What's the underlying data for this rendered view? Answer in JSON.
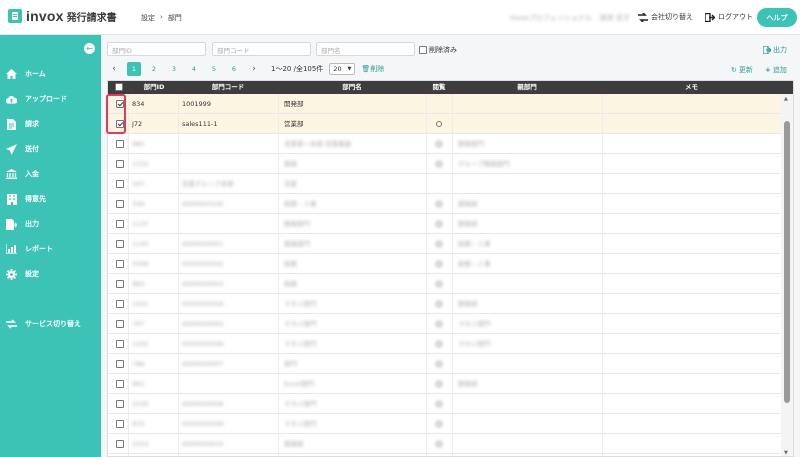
{
  "header": {
    "logo": "invox",
    "logo_sub": "発行請求書",
    "breadcrumb": [
      "設定",
      "›",
      "部門"
    ],
    "user_org": "invoxプロフェッショナル",
    "user_name": "請求 花子",
    "switch_company": "会社切り替え",
    "logout": "ログアウト",
    "help": "ヘルプ"
  },
  "sidebar": {
    "collapse_icon": "arrow-left-icon",
    "items": [
      {
        "label": "ホーム",
        "icon": "home-icon"
      },
      {
        "label": "アップロード",
        "icon": "cloud-upload-icon"
      },
      {
        "label": "請求",
        "icon": "document-icon"
      },
      {
        "label": "送付",
        "icon": "send-icon"
      },
      {
        "label": "入金",
        "icon": "bank-icon"
      },
      {
        "label": "得意先",
        "icon": "building-icon"
      },
      {
        "label": "出力",
        "icon": "export-icon"
      },
      {
        "label": "レポート",
        "icon": "chart-icon"
      },
      {
        "label": "設定",
        "icon": "gear-icon"
      },
      {
        "label": "サービス切り替え",
        "icon": "switch-icon"
      }
    ]
  },
  "filters": {
    "dept_id_placeholder": "部門ID",
    "dept_code_placeholder": "部門コード",
    "dept_name_placeholder": "部門名",
    "deleted_label": "削除済み"
  },
  "toolbar": {
    "export": "出力",
    "refresh": "更新",
    "add": "追加",
    "delete": "削除"
  },
  "pagination": {
    "prev": "‹",
    "next": "›",
    "pages": [
      "1",
      "2",
      "3",
      "4",
      "5",
      "6"
    ],
    "active_page": "1",
    "range": "1〜20 /全105件",
    "per_page": "20"
  },
  "table": {
    "columns": [
      "部門ID",
      "部門コード",
      "部門名",
      "閲覧",
      "親部門",
      "メモ"
    ],
    "rows": [
      {
        "checked": true,
        "id": "834",
        "code": "1001999",
        "name": "開発部",
        "view": "",
        "parent": "",
        "memo": ""
      },
      {
        "checked": true,
        "id": "J72",
        "code": "sales111-1",
        "name": "営業部",
        "view": "○",
        "parent": "",
        "memo": ""
      },
      {
        "checked": false,
        "id": "980",
        "code": "",
        "name": "営業第一本部 営業推進",
        "view": "○",
        "parent": "開発部門",
        "memo": ""
      },
      {
        "checked": false,
        "id": "1152",
        "code": "",
        "name": "開発",
        "view": "○",
        "parent": "グループ開発部門",
        "memo": ""
      },
      {
        "checked": false,
        "id": "167",
        "code": "営業グループ本部",
        "name": "営業",
        "view": "",
        "parent": "",
        "memo": ""
      },
      {
        "checked": false,
        "id": "339",
        "code": "0000000100",
        "name": "総務・人事",
        "view": "○",
        "parent": "開発部",
        "memo": ""
      },
      {
        "checked": false,
        "id": "1137",
        "code": "",
        "name": "開発部門",
        "view": "○",
        "parent": "開発部",
        "memo": ""
      },
      {
        "checked": false,
        "id": "1145",
        "code": "0000000001",
        "name": "開発部門",
        "view": "○",
        "parent": "総務・人事",
        "memo": ""
      },
      {
        "checked": false,
        "id": "3306",
        "code": "0000000002",
        "name": "総務",
        "view": "○",
        "parent": "総務・人事",
        "memo": ""
      },
      {
        "checked": false,
        "id": "983",
        "code": "0000000003",
        "name": "総務",
        "view": "○",
        "parent": "",
        "memo": ""
      },
      {
        "checked": false,
        "id": "1431",
        "code": "0000000004",
        "name": "マネジ部門",
        "view": "○",
        "parent": "開発部",
        "memo": ""
      },
      {
        "checked": false,
        "id": "767",
        "code": "0000000005",
        "name": "マネジ部門",
        "view": "○",
        "parent": "マネジ部門",
        "memo": ""
      },
      {
        "checked": false,
        "id": "1232",
        "code": "0000000006",
        "name": "マネジ部門",
        "view": "○",
        "parent": "マネジ部門",
        "memo": ""
      },
      {
        "checked": false,
        "id": "788",
        "code": "0000000007",
        "name": "部門",
        "view": "○",
        "parent": "",
        "memo": ""
      },
      {
        "checked": false,
        "id": "961",
        "code": "",
        "name": "Excel部門",
        "view": "○",
        "parent": "開発部",
        "memo": ""
      },
      {
        "checked": false,
        "id": "1030",
        "code": "0000000008",
        "name": "マネジ部門",
        "view": "○",
        "parent": "",
        "memo": ""
      },
      {
        "checked": false,
        "id": "870",
        "code": "0000000009",
        "name": "マネジ部門",
        "view": "○",
        "parent": "",
        "memo": ""
      },
      {
        "checked": false,
        "id": "1014",
        "code": "0000000010",
        "name": "開発部",
        "view": "○",
        "parent": "",
        "memo": ""
      }
    ]
  },
  "colors": {
    "accent": "#3cc3b5",
    "header_dark": "#3d3d3d",
    "selected_row": "#fcf5e2",
    "highlight": "#e23a5c"
  }
}
